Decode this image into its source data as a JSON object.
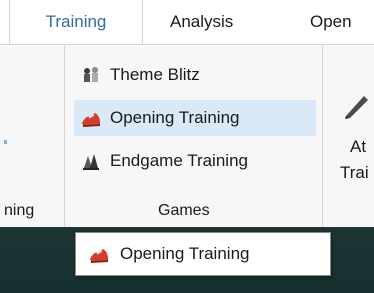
{
  "tabs": {
    "active": "Training",
    "analysis": "Analysis",
    "open_partial": "Open"
  },
  "ribbon": {
    "left_group_label": "ning",
    "games_group": {
      "label": "Games",
      "buttons": [
        {
          "label": "Theme Blitz",
          "icon": "chess-pieces-icon"
        },
        {
          "label": "Opening Training",
          "icon": "red-shoe-icon",
          "highlighted": true
        },
        {
          "label": "Endgame Training",
          "icon": "pieces-icon"
        }
      ]
    },
    "right_button": {
      "label_line1": "At",
      "label_line2": "Trai",
      "icon": "pen-icon"
    }
  },
  "popup": {
    "label": "Opening Training",
    "icon": "red-shoe-icon"
  },
  "colors": {
    "active_tab_text": "#2e6da4",
    "highlight": "#d9e9f7",
    "bottom_bar": "#1f3333"
  }
}
